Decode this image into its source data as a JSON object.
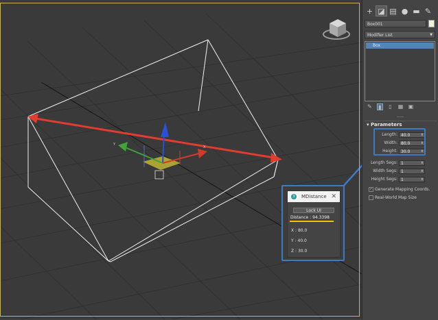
{
  "command_panel": {
    "tabs": [
      {
        "icon": "plus-create-icon",
        "glyph": "+"
      },
      {
        "icon": "modify-icon",
        "glyph": "◪",
        "active": true
      },
      {
        "icon": "hierarchy-icon",
        "glyph": "▤"
      },
      {
        "icon": "motion-icon",
        "glyph": "●"
      },
      {
        "icon": "display-icon",
        "glyph": "▬"
      },
      {
        "icon": "utilities-icon",
        "glyph": "✎"
      }
    ],
    "object_name": "Box001",
    "object_color": "#f2f0d6",
    "modifier_list_label": "Modifier List",
    "stack_items": [
      "Box"
    ],
    "parameters": {
      "title": "Parameters",
      "length_label": "Length:",
      "length_value": "40.0",
      "width_label": "Width:",
      "width_value": "80.0",
      "height_label": "Height:",
      "height_value": "30.0",
      "length_segs_label": "Length Segs:",
      "length_segs_value": "1",
      "width_segs_label": "Width Segs:",
      "width_segs_value": "1",
      "height_segs_label": "Height Segs:",
      "height_segs_value": "1",
      "generate_mapping_label": "Generate Mapping Coords.",
      "generate_mapping_checked": true,
      "real_world_label": "Real-World Map Size",
      "real_world_checked": false
    }
  },
  "mdistance": {
    "title": "MDistance",
    "lock_ui_label": "Lock UI",
    "distance_text": "Distance : 94.3398",
    "x_text": "X : 80.0",
    "y_text": "Y : 40.0",
    "z_text": "Z : 30.0"
  },
  "colors": {
    "measure_arrow": "#e03c2f",
    "callout_blue": "#3c7bc6",
    "gizmo_x": "#d23a2a",
    "gizmo_y": "#3fa33a",
    "gizmo_z": "#2b4fd8",
    "highlight_yellow": "#f4c200"
  }
}
